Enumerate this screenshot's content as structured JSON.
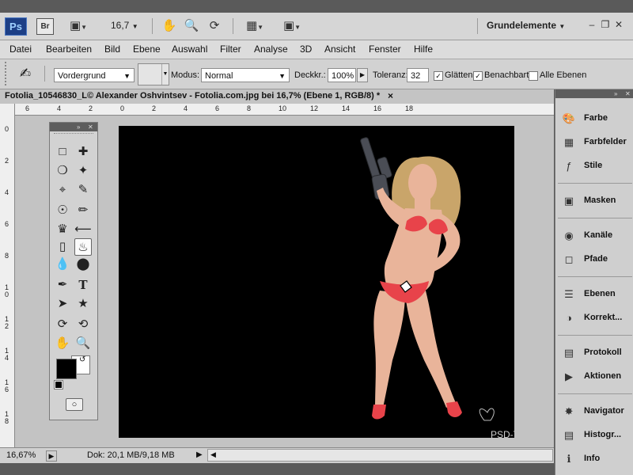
{
  "appbar": {
    "logo": "Ps",
    "bridge": "Br",
    "zoom": "16,7",
    "workspace": "Grundelemente",
    "icons": [
      "film-icon",
      "hand-icon",
      "zoom-icon",
      "rotate-view-icon",
      "arrange-icon",
      "screen-mode-icon"
    ]
  },
  "menu": {
    "items": [
      "Datei",
      "Bearbeiten",
      "Bild",
      "Ebene",
      "Auswahl",
      "Filter",
      "Analyse",
      "3D",
      "Ansicht",
      "Fenster",
      "Hilfe"
    ]
  },
  "options": {
    "fill_source": "Vordergrund",
    "mode_label": "Modus:",
    "mode_value": "Normal",
    "opacity_label": "Deckkr.:",
    "opacity_value": "100%",
    "tolerance_label": "Toleranz:",
    "tolerance_value": "32",
    "smooth_label": "Glätten",
    "contiguous_label": "Benachbart",
    "all_layers_label": "Alle Ebenen",
    "smooth_checked": true,
    "contiguous_checked": true,
    "all_layers_checked": false
  },
  "document": {
    "title": "Fotolia_10546830_L© Alexander Oshvintsev - Fotolia.com.jpg bei 16,7% (Ebene 1, RGB/8) *",
    "close": "×"
  },
  "rulers": {
    "h_labels": [
      "6",
      "4",
      "2",
      "0",
      "2",
      "4",
      "6",
      "8",
      "10",
      "12",
      "14",
      "16",
      "18"
    ],
    "v_labels": [
      "0",
      "2",
      "4",
      "6",
      "8",
      "1\n0",
      "1\n2",
      "1\n4",
      "1\n6",
      "1\n8"
    ]
  },
  "panels": {
    "groups": [
      [
        {
          "label": "Farbe",
          "icon": "color-icon"
        },
        {
          "label": "Farbfelder",
          "icon": "swatches-icon"
        },
        {
          "label": "Stile",
          "icon": "styles-icon"
        }
      ],
      [
        {
          "label": "Masken",
          "icon": "masks-icon"
        }
      ],
      [
        {
          "label": "Kanäle",
          "icon": "channels-icon"
        },
        {
          "label": "Pfade",
          "icon": "paths-icon"
        }
      ],
      [
        {
          "label": "Ebenen",
          "icon": "layers-icon"
        },
        {
          "label": "Korrekt...",
          "icon": "adjustments-icon"
        }
      ],
      [
        {
          "label": "Protokoll",
          "icon": "history-icon"
        },
        {
          "label": "Aktionen",
          "icon": "actions-icon"
        }
      ],
      [
        {
          "label": "Navigator",
          "icon": "navigator-icon"
        },
        {
          "label": "Histogr...",
          "icon": "histogram-icon"
        },
        {
          "label": "Info",
          "icon": "info-icon"
        }
      ]
    ]
  },
  "status": {
    "zoom": "16,67%",
    "doc": "Dok: 20,1 MB/9,18 MB"
  },
  "watermark": "PSD-Tutorials.de",
  "colors": {
    "foreground": "#000000",
    "background": "#ffffff",
    "bikini": "#e8434a",
    "skin": "#e9b49a"
  }
}
